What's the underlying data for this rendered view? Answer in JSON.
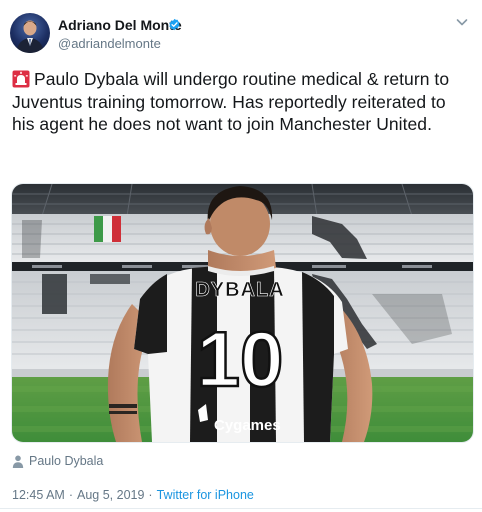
{
  "author": {
    "name": "Adriano Del Monte",
    "handle": "@adriandelmonte"
  },
  "tweet": {
    "text": "Paulo Dybala will undergo routine medical & return to Juventus training tomorrow. Has reportedly reiterated to his agent he does not want to join Manchester United."
  },
  "media": {
    "jersey_name": "DYBALA",
    "jersey_number": "10",
    "sponsor": "Cygames"
  },
  "tagged": {
    "person": "Paulo Dybala"
  },
  "meta": {
    "time": "12:45 AM",
    "separator": "·",
    "date": "Aug 5, 2019",
    "source": "Twitter for iPhone"
  },
  "colors": {
    "link": "#1b95e0",
    "verified": "#1da1f2",
    "secondary_text": "#657786",
    "pitch": "#3f8d3a"
  },
  "icons": [
    "verified-badge-icon",
    "chevron-down-icon",
    "siren-emoji-icon",
    "person-icon"
  ]
}
